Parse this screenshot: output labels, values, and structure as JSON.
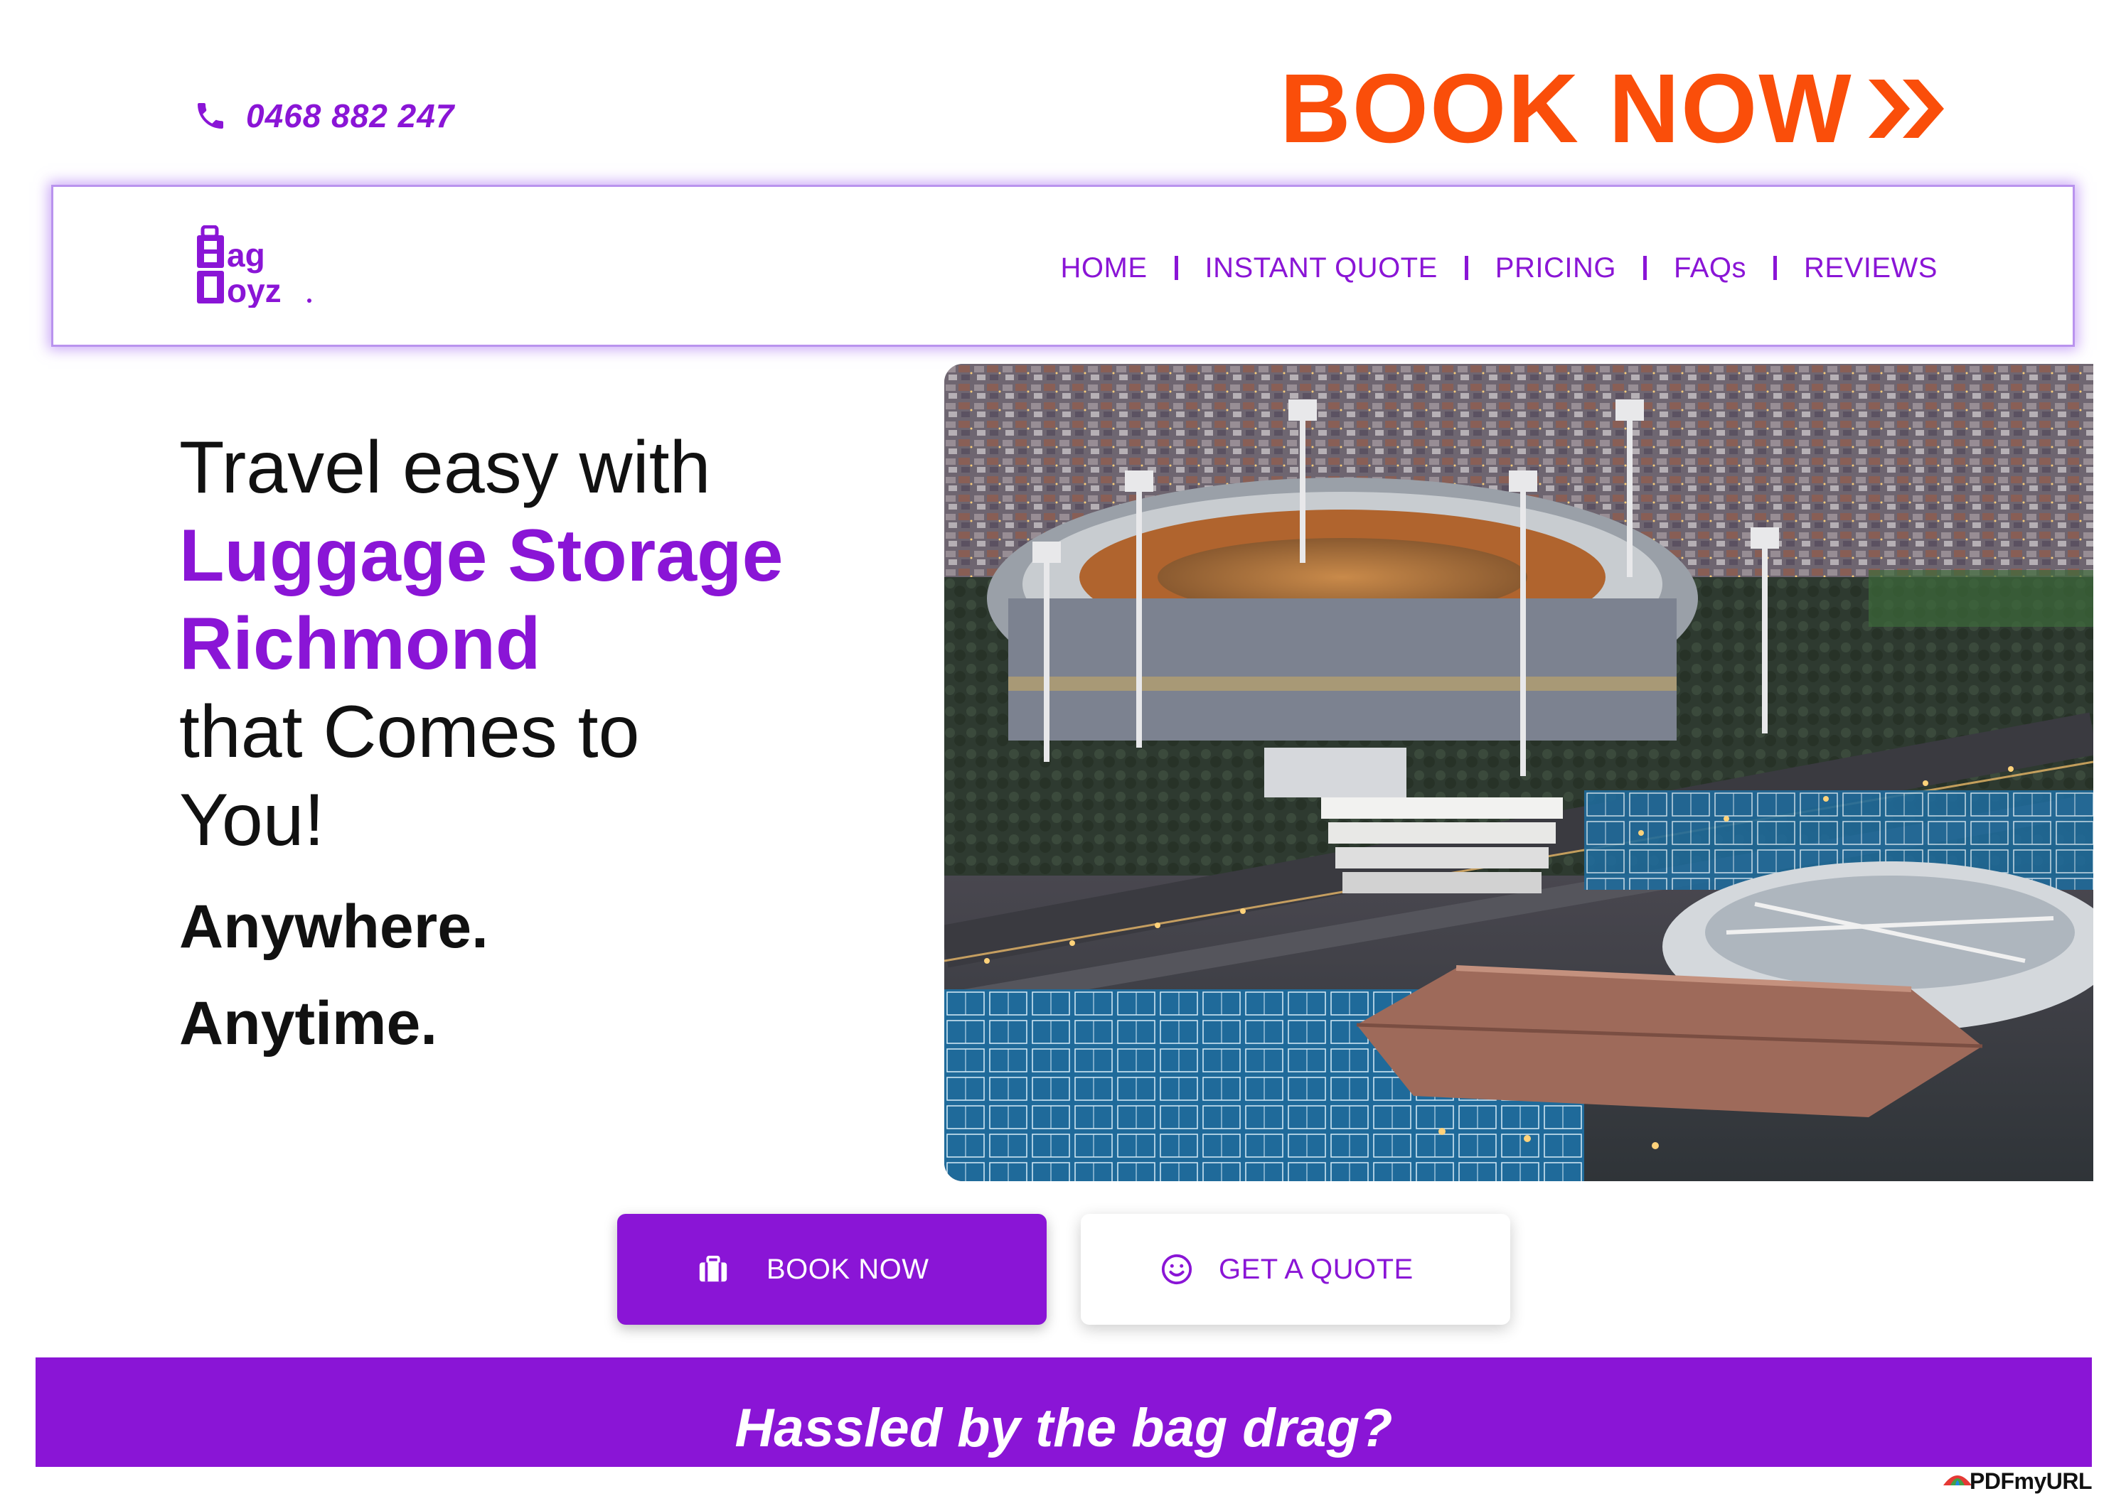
{
  "header": {
    "phone": "0468 882 247",
    "book_now": "BOOK NOW"
  },
  "nav": {
    "logo_text": "Bag Boyz",
    "items": [
      {
        "label": "HOME"
      },
      {
        "label": "INSTANT QUOTE"
      },
      {
        "label": "PRICING"
      },
      {
        "label": "FAQs"
      },
      {
        "label": "REVIEWS"
      }
    ]
  },
  "hero": {
    "line1": "Travel easy with",
    "accent1": "Luggage Storage",
    "accent2": "Richmond",
    "line2": "that Comes to",
    "line3": "You!",
    "tagline1": "Anywhere.",
    "tagline2": "Anytime."
  },
  "buttons": {
    "book_now": "BOOK NOW",
    "get_quote": "GET A QUOTE"
  },
  "banner": {
    "text": "Hassled by the bag drag?"
  },
  "watermark": {
    "text": "PDFmyURL"
  },
  "colors": {
    "brand_purple": "#8a15d6",
    "accent_orange": "#fa4e0a"
  },
  "icons": {
    "phone": "phone-icon",
    "chevrons": "double-chevron-right-icon",
    "suitcase": "suitcase-icon",
    "smile": "smile-icon"
  }
}
